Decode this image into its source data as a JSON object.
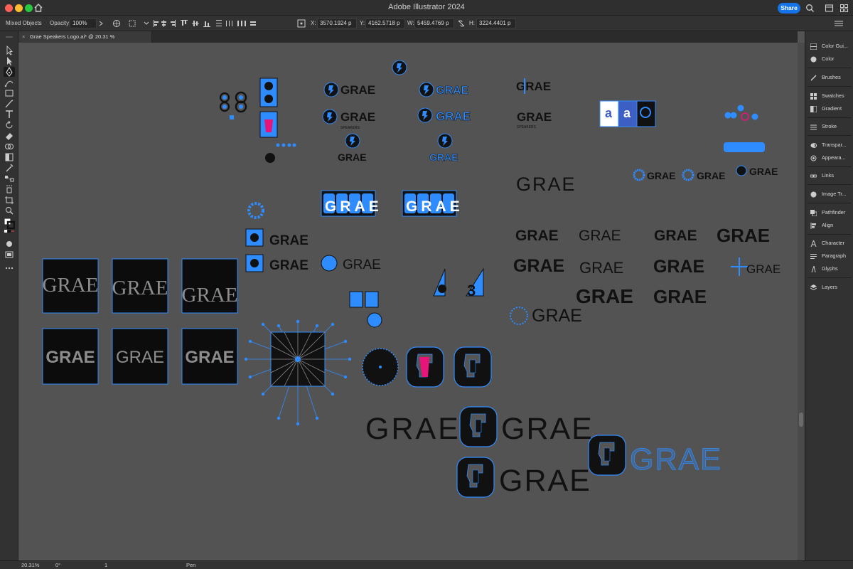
{
  "app": {
    "title": "Adobe Illustrator 2024",
    "share_label": "Share"
  },
  "control_bar": {
    "selection_type": "Mixed Objects",
    "opacity_label": "Opacity:",
    "opacity_value": "100%",
    "x_label": "X:",
    "x_value": "3570.1924 p",
    "y_label": "Y:",
    "y_value": "4162.5718 p",
    "w_label": "W:",
    "w_value": "5459.4769 p",
    "h_label": "H:",
    "h_value": "3224.4401 p"
  },
  "document_tab": {
    "title": "Grae Speakers Logo.ai* @ 20.31 % (CMYK/Preview)"
  },
  "tools": [
    "selection-tool",
    "direct-selection-tool",
    "pen-tool",
    "curvature-tool",
    "rectangle-tool",
    "paintbrush-tool",
    "type-tool",
    "rotate-tool",
    "eraser-tool",
    "shape-builder-tool",
    "gradient-tool",
    "eyedropper-tool",
    "blend-tool",
    "symbol-sprayer-tool",
    "artboard-tool",
    "zoom-tool",
    "fill-stroke",
    "drawing-modes",
    "screen-mode",
    "edit-toolbar"
  ],
  "panels": [
    {
      "label": "Color Gui...",
      "icon": "color-guide-icon"
    },
    {
      "label": "Color",
      "icon": "color-icon"
    },
    {
      "label": "Brushes",
      "icon": "brushes-icon"
    },
    {
      "label": "Swatches",
      "icon": "swatches-icon"
    },
    {
      "label": "Gradient",
      "icon": "gradient-icon"
    },
    {
      "label": "Stroke",
      "icon": "stroke-icon"
    },
    {
      "label": "Transpar...",
      "icon": "transparency-icon"
    },
    {
      "label": "Appeara...",
      "icon": "appearance-icon"
    },
    {
      "label": "Links",
      "icon": "links-icon"
    },
    {
      "label": "Image Tr...",
      "icon": "image-trace-icon"
    },
    {
      "label": "Pathfinder",
      "icon": "pathfinder-icon"
    },
    {
      "label": "Align",
      "icon": "align-icon"
    },
    {
      "label": "Character",
      "icon": "character-icon"
    },
    {
      "label": "Paragraph",
      "icon": "paragraph-icon"
    },
    {
      "label": "Glyphs",
      "icon": "glyphs-icon"
    },
    {
      "label": "Layers",
      "icon": "layers-icon"
    }
  ],
  "status_bar": {
    "zoom": "20.31%",
    "rotation": "0°",
    "artboard": "1",
    "tool_name": "Pen"
  },
  "artwork": {
    "wordmark": "GRAE",
    "sub_wordmark": "SPEAKERS",
    "glyph_a": "a",
    "selection_color": "#2f8cff",
    "highlight_color": "#e8147a",
    "artboard_text_color": "#8c8c8c"
  }
}
